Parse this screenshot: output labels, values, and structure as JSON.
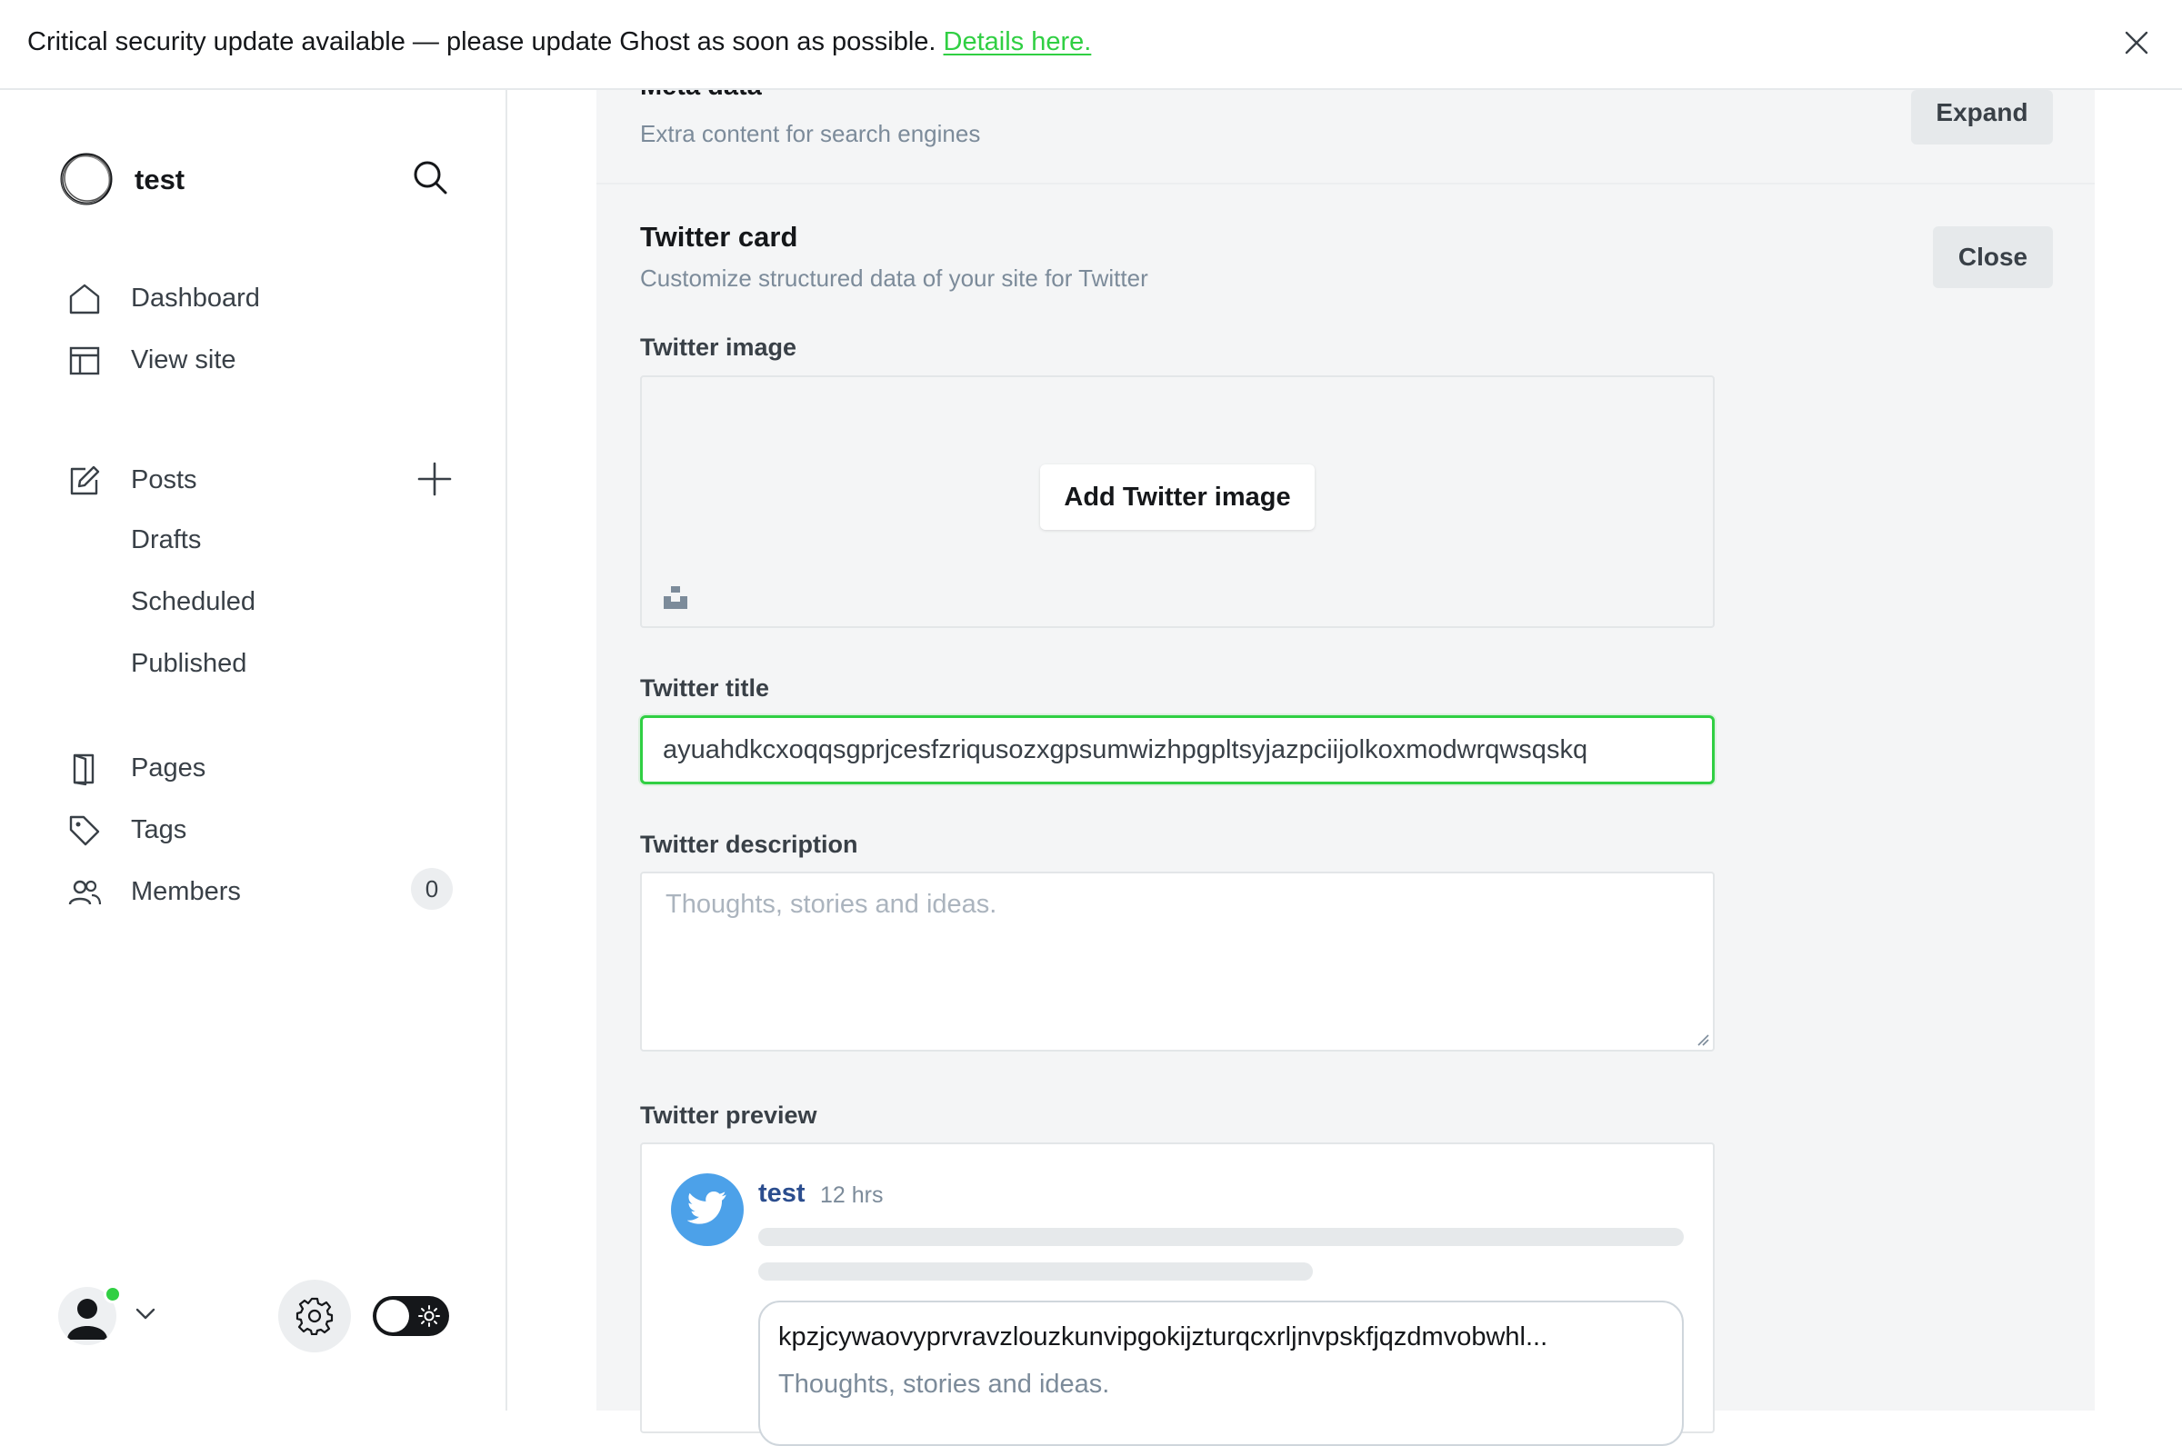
{
  "banner": {
    "message": "Critical security update available — please update Ghost as soon as possible.",
    "link": "Details here."
  },
  "sidebar": {
    "site_name": "test",
    "nav": {
      "dashboard": "Dashboard",
      "view_site": "View site",
      "posts": "Posts",
      "drafts": "Drafts",
      "scheduled": "Scheduled",
      "published": "Published",
      "pages": "Pages",
      "tags": "Tags",
      "members": "Members",
      "members_count": "0"
    }
  },
  "main": {
    "meta": {
      "title": "Meta data",
      "description": "Extra content for search engines",
      "expand_label": "Expand"
    },
    "twitter": {
      "title": "Twitter card",
      "subtitle": "Customize structured data of your site for Twitter",
      "close_label": "Close",
      "image_label": "Twitter image",
      "add_image_label": "Add Twitter image",
      "title_label": "Twitter title",
      "title_value": "ayuahdkcxoqqsgprjcesfzriqusozxgpsumwizhpgpltsyjazpciijolkoxmodwrqwsqskq",
      "description_label": "Twitter description",
      "description_placeholder": "Thoughts, stories and ideas.",
      "preview_label": "Twitter preview",
      "preview": {
        "name": "test",
        "time": "12 hrs",
        "card_title": "kpzjcywaovyprvravzlouzkunvipgokijzturqcxrljnvpskfjqzdmvobwhl...",
        "card_description": "Thoughts, stories and ideas."
      }
    }
  },
  "colors": {
    "accent": "#30cf43",
    "twitter_blue": "#4ca1e9",
    "panel_bg": "#f4f5f6"
  }
}
